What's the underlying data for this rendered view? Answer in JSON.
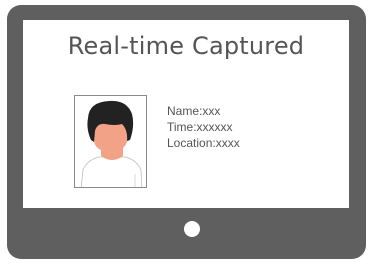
{
  "screen": {
    "title": "Real-time Captured"
  },
  "photo": {
    "icon": "person-portrait-icon"
  },
  "info": {
    "name": "Name:xxx",
    "time": "Time:xxxxxx",
    "location": "Location:xxxx"
  },
  "colors": {
    "device_frame": "#5f5f5f",
    "screen_background": "#ffffff",
    "text": "#555555",
    "hair": "#222222",
    "skin": "#f2a286",
    "shirt": "#ffffff"
  }
}
